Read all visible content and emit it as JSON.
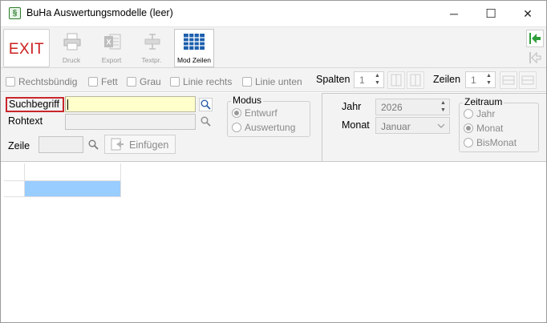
{
  "window": {
    "title": "BuHa Auswertungsmodelle (leer)",
    "icon": "buha-app-icon",
    "icon_glyph": "§",
    "minimize_glyph": "─",
    "maximize_glyph": "☐",
    "close_glyph": "✕"
  },
  "toolbar": {
    "exit_label": "EXIT",
    "druck_label": "Druck",
    "export_label": "Export",
    "textpr_label": "Textpr.",
    "modzeilen_label": "Mod Zeilen"
  },
  "options": {
    "rechtsbuendig": "Rechtsbündig",
    "fett": "Fett",
    "grau": "Grau",
    "linie_rechts": "Linie rechts",
    "linie_unten": "Linie unten",
    "spalten_label": "Spalten",
    "spalten_value": "1",
    "zeilen_label": "Zeilen",
    "zeilen_value": "1"
  },
  "form": {
    "suchbegriff_label": "Suchbegriff",
    "suchbegriff_value": "",
    "rohtext_label": "Rohtext",
    "rohtext_value": "",
    "zeile_label": "Zeile",
    "zeile_value": "",
    "einfuegen_label": "Einfügen",
    "modus": {
      "title": "Modus",
      "options": [
        "Entwurf",
        "Auswertung"
      ],
      "selected": "Entwurf"
    },
    "jahr_label": "Jahr",
    "jahr_value": "2026",
    "monat_label": "Monat",
    "monat_value": "Januar",
    "zeitraum": {
      "title": "Zeitraum",
      "options": [
        "Jahr",
        "Monat",
        "BisMonat"
      ],
      "selected": "Monat"
    }
  },
  "colors": {
    "exit_red": "#cc1f1f",
    "highlight_border": "#c8262b",
    "search_bg": "#ffffcc",
    "grid_selection": "#99ccff",
    "nav_green": "#2e9e3a"
  }
}
